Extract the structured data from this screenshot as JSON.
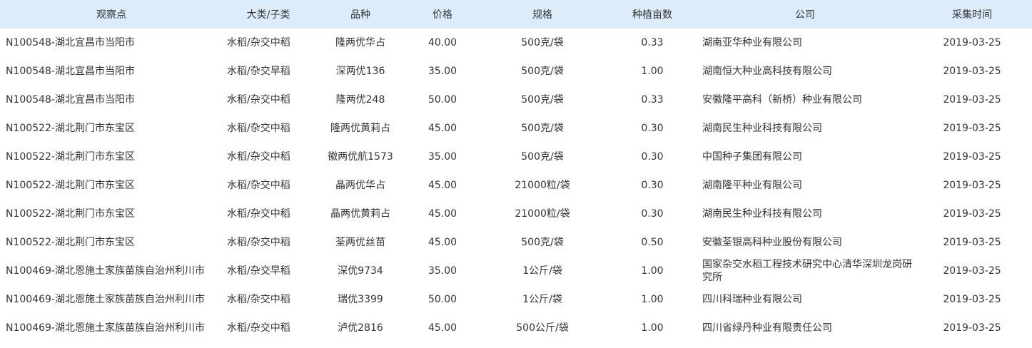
{
  "table": {
    "headers": [
      "观察点",
      "大类/子类",
      "品种",
      "价格",
      "规格",
      "种植亩数",
      "公司",
      "采集时间"
    ],
    "rows": [
      [
        "N100548-湖北宜昌市当阳市",
        "水稻/杂交中稻",
        "隆两优华占",
        "40.00",
        "500克/袋",
        "0.33",
        "湖南亚华种业有限公司",
        "2019-03-25"
      ],
      [
        "N100548-湖北宜昌市当阳市",
        "水稻/杂交早稻",
        "深两优136",
        "35.00",
        "500克/袋",
        "1.00",
        "湖南恒大种业高科技有限公司",
        "2019-03-25"
      ],
      [
        "N100548-湖北宜昌市当阳市",
        "水稻/杂交中稻",
        "隆两优248",
        "50.00",
        "500克/袋",
        "0.33",
        "安徽隆平高科（新桥）种业有限公司",
        "2019-03-25"
      ],
      [
        "N100522-湖北荆门市东宝区",
        "水稻/杂交中稻",
        "隆两优黄莉占",
        "45.00",
        "500克/袋",
        "0.30",
        "湖南民生种业科技有限公司",
        "2019-03-25"
      ],
      [
        "N100522-湖北荆门市东宝区",
        "水稻/杂交中稻",
        "徽两优航1573",
        "35.00",
        "500克/袋",
        "0.30",
        "中国种子集团有限公司",
        "2019-03-25"
      ],
      [
        "N100522-湖北荆门市东宝区",
        "水稻/杂交中稻",
        "晶两优华占",
        "45.00",
        "21000粒/袋",
        "0.30",
        "湖南隆平种业有限公司",
        "2019-03-25"
      ],
      [
        "N100522-湖北荆门市东宝区",
        "水稻/杂交中稻",
        "晶两优黄莉占",
        "45.00",
        "21000粒/袋",
        "0.30",
        "湖南民生种业科技有限公司",
        "2019-03-25"
      ],
      [
        "N100522-湖北荆门市东宝区",
        "水稻/杂交中稻",
        "荃两优丝苗",
        "45.00",
        "500克/袋",
        "0.50",
        "安徽荃银高科种业股份有限公司",
        "2019-03-25"
      ],
      [
        "N100469-湖北恩施土家族苗族自治州利川市",
        "水稻/杂交早稻",
        "深优9734",
        "35.00",
        "1公斤/袋",
        "1.00",
        "国家杂交水稻工程技术研究中心清华深圳龙岗研究所",
        "2019-03-25"
      ],
      [
        "N100469-湖北恩施土家族苗族自治州利川市",
        "水稻/杂交中稻",
        "瑞优3399",
        "50.00",
        "1公斤/袋",
        "1.00",
        "四川科瑞种业有限公司",
        "2019-03-25"
      ],
      [
        "N100469-湖北恩施土家族苗族自治州利川市",
        "水稻/杂交中稻",
        "泸优2816",
        "45.00",
        "500公斤/袋",
        "1.00",
        "四川省绿丹种业有限责任公司",
        "2019-03-25"
      ]
    ]
  },
  "colors": {
    "header_bg": "#dcecfb",
    "text": "#333333",
    "background": "#ffffff"
  }
}
